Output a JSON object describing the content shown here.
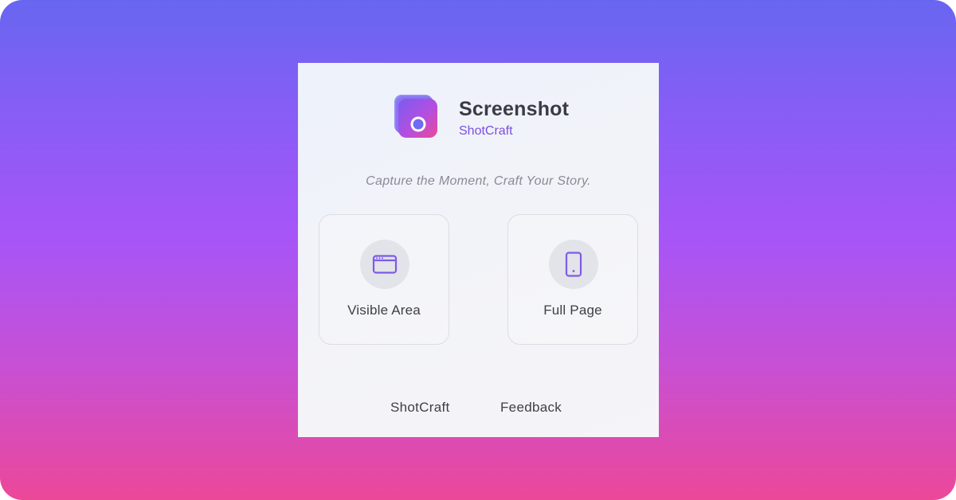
{
  "app": {
    "title": "Screenshot",
    "subtitle": "ShotCraft",
    "tagline": "Capture the Moment, Craft Your Story.",
    "icon": "app-logo-icon"
  },
  "actions": [
    {
      "label": "Visible Area",
      "icon": "browser-window-icon"
    },
    {
      "label": "Full Page",
      "icon": "tablet-device-icon"
    }
  ],
  "footer": {
    "links": [
      {
        "label": "ShotCraft"
      },
      {
        "label": "Feedback"
      }
    ]
  },
  "colors": {
    "background_gradient": [
      "#6866f1",
      "#a855f7",
      "#ec4899"
    ],
    "accent": "#7b4fe0",
    "icon_stroke": "#7c5ce6"
  }
}
